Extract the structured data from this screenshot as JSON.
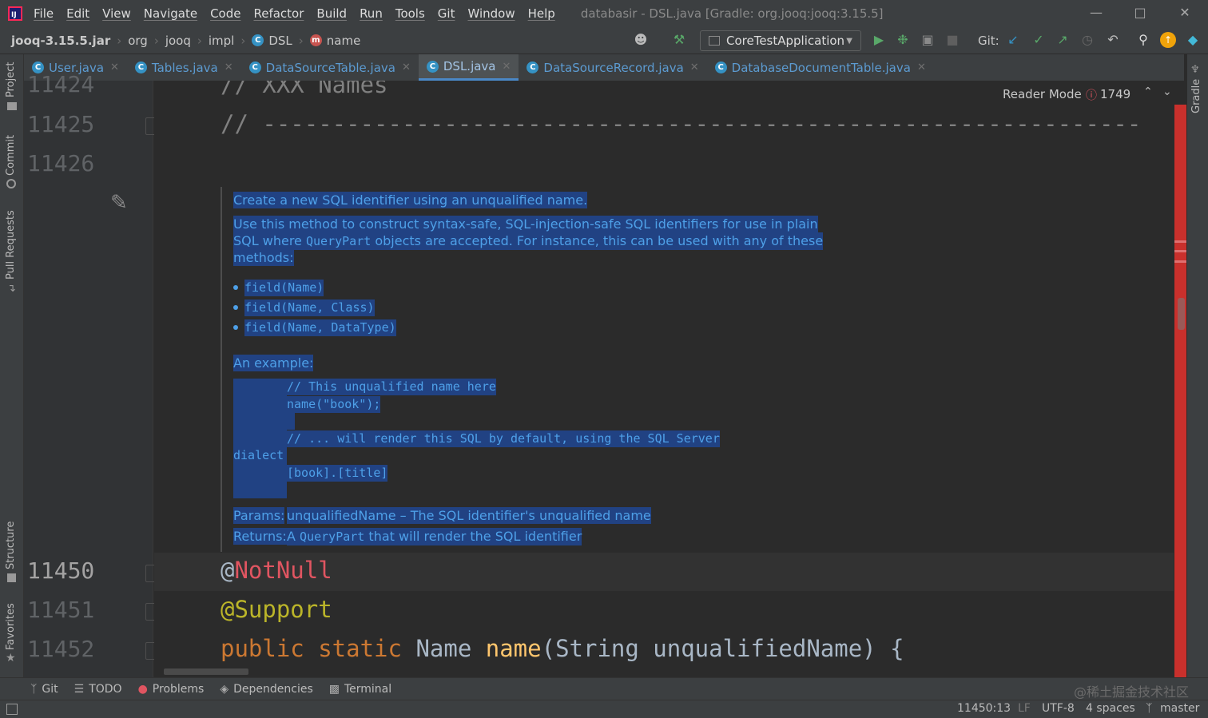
{
  "menu": {
    "app_logo": "IJ",
    "items": [
      "File",
      "Edit",
      "View",
      "Navigate",
      "Code",
      "Refactor",
      "Build",
      "Run",
      "Tools",
      "Git",
      "Window",
      "Help"
    ],
    "window_title": "databasir - DSL.java [Gradle: org.jooq:jooq:3.15.5]"
  },
  "breadcrumb": {
    "jar": "jooq-3.15.5.jar",
    "pkg1": "org",
    "pkg2": "jooq",
    "pkg3": "impl",
    "class": "DSL",
    "member": "name"
  },
  "toolbar": {
    "run_config": "CoreTestApplication",
    "git_label": "Git:"
  },
  "tabs": [
    {
      "label": "User.java",
      "active": false
    },
    {
      "label": "Tables.java",
      "active": false
    },
    {
      "label": "DataSourceTable.java",
      "active": false
    },
    {
      "label": "DSL.java",
      "active": true
    },
    {
      "label": "DataSourceRecord.java",
      "active": false
    },
    {
      "label": "DatabaseDocumentTable.java",
      "active": false
    }
  ],
  "left_tools": {
    "project": "Project",
    "commit": "Commit",
    "pull_requests": "Pull Requests",
    "structure": "Structure",
    "favorites": "Favorites"
  },
  "right_tools": {
    "gradle": "Gradle"
  },
  "editor": {
    "reader_mode": "Reader Mode",
    "error_count": "1749",
    "line_numbers": {
      "l1": "11424",
      "l2": "11425",
      "l3": "11426",
      "l4": "11450",
      "l5": "11451",
      "l6": "11452"
    },
    "code": {
      "l1": "// XXX Names",
      "l2": "// ---------------------------------------------------------------",
      "l4": "@NotNull",
      "l5": "@Support",
      "l6_kw": "public static",
      "l6_type": "Name",
      "l6_method": "name",
      "l6_rest": "(String unqualifiedName) {"
    },
    "doc": {
      "summary": "Create a new SQL identifier using an unqualified name.",
      "para1": "Use this method to construct syntax-safe, SQL-injection-safe SQL identifiers for use in plain",
      "para2a": "SQL where",
      "para2b": "QueryPart",
      "para2c": "objects are accepted. For instance, this can be used with any of these",
      "para3": "methods:",
      "bullets": [
        "field(Name)",
        "field(Name, Class)",
        "field(Name, DataType)"
      ],
      "example_label": "An example:",
      "ex1": "// This unqualified name here",
      "ex2": "name(\"book\");",
      "ex3": "// ... will render this SQL by default, using the SQL Server",
      "ex4": "dialect",
      "ex5": "[book].[title]",
      "params_label": "Params:",
      "params_value": "unqualifiedName – The SQL identifier's unqualified name",
      "returns_label": "Returns:",
      "returns_value_a": "A",
      "returns_value_b": "QueryPart",
      "returns_value_c": "that will render the SQL identifier"
    }
  },
  "bottom_tools": {
    "git": "Git",
    "todo": "TODO",
    "problems": "Problems",
    "dependencies": "Dependencies",
    "terminal": "Terminal",
    "watermark": "@稀土掘金技术社区"
  },
  "status": {
    "position": "11450:13",
    "line_sep": "LF",
    "encoding": "UTF-8",
    "indent": "4 spaces",
    "branch": "master"
  },
  "colors": {
    "background": "#2b2b2b",
    "selection": "#214283",
    "doc_text": "#4ea0e8",
    "keyword": "#cc7832",
    "annotation": "#bbb529",
    "error_marker": "#c9302c"
  }
}
